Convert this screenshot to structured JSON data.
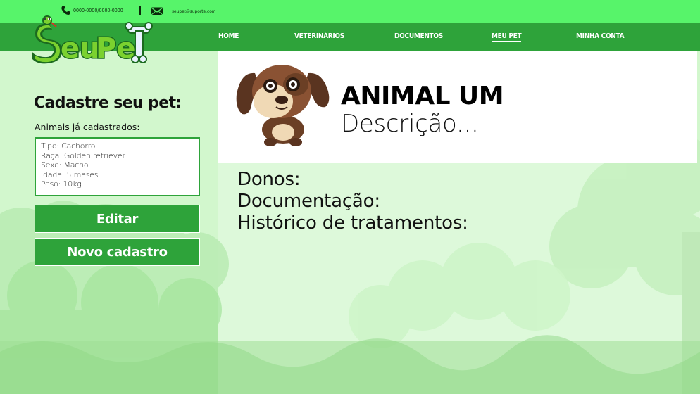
{
  "topbar": {
    "phone_icon": "phone-icon",
    "phone": "0000-0000/0000-0000",
    "mail_icon": "mail-icon",
    "email": "seupet@suporte.com"
  },
  "logo": {
    "text": "SeuPeT"
  },
  "nav": {
    "items": [
      {
        "label": "HOME",
        "active": false
      },
      {
        "label": "VETERINÁRIOS",
        "active": false
      },
      {
        "label": "DOCUMENTOS",
        "active": false
      },
      {
        "label": "MEU PET",
        "active": true
      },
      {
        "label": "MINHA CONTA",
        "active": false
      }
    ]
  },
  "sidebar": {
    "title": "Cadastre seu pet:",
    "subtitle": "Animais já cadastrados:",
    "pet": {
      "tipo": "Tipo: Cachorro",
      "raca": "Raça: Golden retriever",
      "sexo": "Sexo: Macho",
      "idade": "Idade: 5 meses",
      "peso": "Peso: 10kg"
    },
    "edit_label": "Editar",
    "new_label": "Novo cadastro"
  },
  "main": {
    "animal_name": "ANIMAL UM",
    "description": "Descrição...",
    "donos": "Donos:",
    "documentacao": "Documentação:",
    "historico": "Histórico de tratamentos:"
  },
  "colors": {
    "topbar": "#57f46a",
    "nav": "#2ea33a",
    "background": "#cdf6c9",
    "panel": "#ffffff"
  }
}
